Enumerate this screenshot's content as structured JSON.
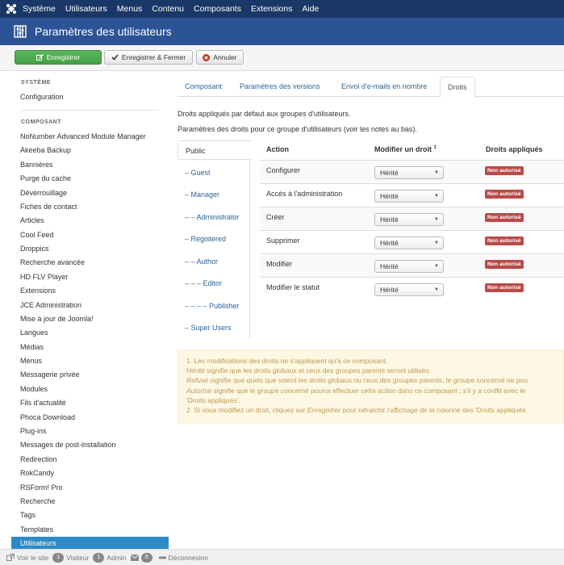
{
  "topbar": {
    "menu": [
      "Système",
      "Utilisateurs",
      "Menus",
      "Contenu",
      "Composants",
      "Extensions",
      "Aide"
    ]
  },
  "header": {
    "title": "Paramètres des utilisateurs"
  },
  "toolbar": {
    "save": "Enregistrer",
    "save_close": "Enregistrer & Fermer",
    "cancel": "Annuler"
  },
  "sidebar": {
    "system_heading": "SYSTÈME",
    "configuration": "Configuration",
    "component_heading": "COMPOSANT",
    "items": [
      "NoNumber Advanced Module Manager",
      "Akeeba Backup",
      "Bannières",
      "Purge du cache",
      "Déverrouillage",
      "Fiches de contact",
      "Articles",
      "Cool Feed",
      "Droppics",
      "Recherche avancée",
      "HD FLV Player",
      "Extensions",
      "JCE Administration",
      "Mise à jour de Joomla!",
      "Langues",
      "Médias",
      "Menus",
      "Messagerie privée",
      "Modules",
      "Fils d'actualité",
      "Phoca Download",
      "Plug-ins",
      "Messages de post-installation",
      "Redirection",
      "RokCandy",
      "RSForm! Pro",
      "Recherche",
      "Tags",
      "Templates",
      "Utilisateurs"
    ]
  },
  "tabs": [
    "Composant",
    "Paramètres des versions",
    "Envoi d'e-mails en nombre",
    "Droits"
  ],
  "intro": {
    "line1": "Droits appliqués par défaut aux groupes d'utilisateurs.",
    "line2": "Paramètres des droits pour ce groupe d'utilisateurs (voir les notes au bas)."
  },
  "groups": [
    "Public",
    "– Guest",
    "– Manager",
    "– – Administrator",
    "– Registered",
    "– – Author",
    "– – – Editor",
    "– – – – Publisher",
    "– Super Users"
  ],
  "table": {
    "col_action": "Action",
    "col_modify": "Modifier un droit",
    "col_modify_sup": "1",
    "col_applied": "Droits appliqués",
    "rows": [
      {
        "action": "Configurer",
        "select": "Hérité",
        "badge": "Non autorisé"
      },
      {
        "action": "Accès à l'administration",
        "select": "Hérité",
        "badge": "Non autorisé"
      },
      {
        "action": "Créer",
        "select": "Hérité",
        "badge": "Non autorisé"
      },
      {
        "action": "Supprimer",
        "select": "Hérité",
        "badge": "Non autorisé"
      },
      {
        "action": "Modifier",
        "select": "Hérité",
        "badge": "Non autorisé"
      },
      {
        "action": "Modifier le statut",
        "select": "Hérité",
        "badge": "Non autorisé"
      }
    ]
  },
  "notes": {
    "n1": "1. Les modifications des droits ne s'appliquent qu'à ce composant.",
    "n2_em": "Hérité",
    "n2": " signifie que les droits globaux et ceux des groupes parents seront utilisés.",
    "n3_em": "Refusé",
    "n3": " signifie que quels que soient les droits globaux ou ceux des groupes parents, le groupe concerné ne pou",
    "n4_em": "Autorisé",
    "n4": " signifie que le groupe concerné pourra effectuer cette action dans ce composant ; s'il y a conflit avec le",
    "n5": "'Droits appliqués'.",
    "n6_a": "2. Si vous modifiez un droit, cliquez sur ",
    "n6_em": "Enregistrer",
    "n6_b": " pour rafraîchir l'affichage de la colonne des 'Droits appliqués"
  },
  "footer": {
    "view_site": "Voir le site",
    "visitors_count": "1",
    "visitors": "Visiteur",
    "admin_count": "1",
    "admin": "Admin",
    "messages_count": "0",
    "logout": "Déconnexion"
  },
  "colors": {
    "topbar": "#1a3867",
    "titlebar": "#2b5396",
    "save_green": "#5bb75b",
    "badge_red": "#b94a48",
    "active_item": "#2d8ac7",
    "link": "#2a6496"
  }
}
